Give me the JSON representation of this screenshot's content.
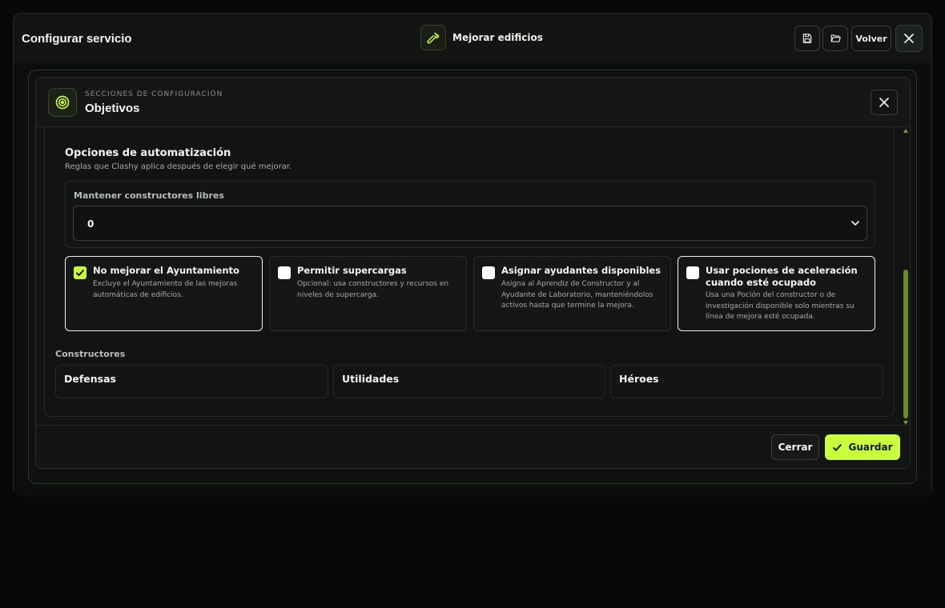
{
  "window": {
    "title": "Configurar servicio",
    "service_name": "Mejorar edificios",
    "back_label": "Volver"
  },
  "modal": {
    "kicker": "SECCIONES DE CONFIGURACIÓN",
    "title": "Objetivos"
  },
  "automation": {
    "title": "Opciones de automatización",
    "description": "Reglas que Clashy aplica después de elegir qué mejorar.",
    "keep_builders_label": "Mantener constructores libres",
    "keep_builders_value": "0"
  },
  "options": [
    {
      "title": "No mejorar el Ayuntamiento",
      "description": "Excluye el Ayuntamiento de las mejoras automáticas de edificios.",
      "checked": true
    },
    {
      "title": "Permitir supercargas",
      "description": "Opcional: usa constructores y recursos en niveles de supercarga.",
      "checked": false
    },
    {
      "title": "Asignar ayudantes disponibles",
      "description": "Asigna al Aprendiz de Constructor y al Ayudante de Laboratorio, manteniéndolos activos hasta que termine la mejora.",
      "checked": false
    },
    {
      "title": "Usar pociones de aceleración cuando esté ocupado",
      "description": "Usa una Poción del constructor o de investigación disponible solo mientras su línea de mejora esté ocupada.",
      "checked": false
    }
  ],
  "builders": {
    "label": "Constructores",
    "cards": [
      "Defensas",
      "Utilidades",
      "Héroes"
    ]
  },
  "footer": {
    "close_label": "Cerrar",
    "save_label": "Guardar"
  },
  "colors": {
    "accent": "#c9ff3d",
    "background": "#070807",
    "panel": "#111412"
  }
}
